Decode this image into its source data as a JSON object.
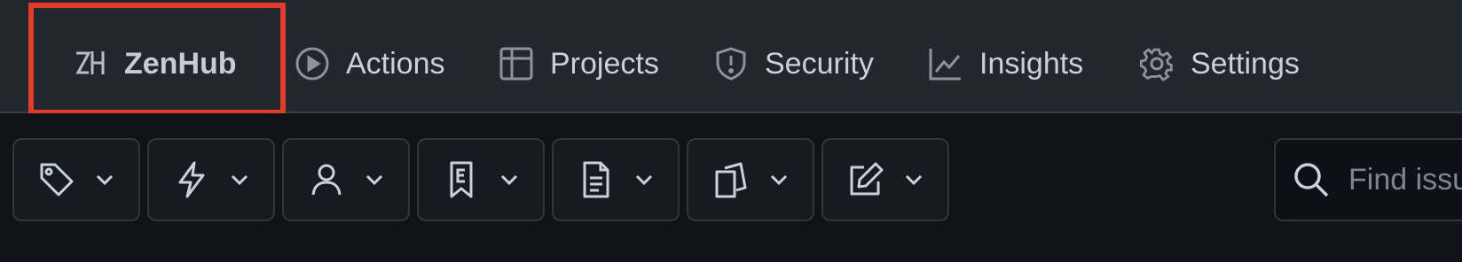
{
  "tabs": [
    {
      "label": "ZenHub",
      "icon": "zenhub-logo-icon"
    },
    {
      "label": "Actions",
      "icon": "play-circle-icon"
    },
    {
      "label": "Projects",
      "icon": "table-icon"
    },
    {
      "label": "Security",
      "icon": "shield-icon"
    },
    {
      "label": "Insights",
      "icon": "graph-icon"
    },
    {
      "label": "Settings",
      "icon": "gear-icon"
    }
  ],
  "highlight_color": "#e23b2a",
  "filters": [
    {
      "icon": "tag-icon"
    },
    {
      "icon": "lightning-icon"
    },
    {
      "icon": "person-icon"
    },
    {
      "icon": "epic-bookmark-icon"
    },
    {
      "icon": "document-icon"
    },
    {
      "icon": "copy-icon"
    },
    {
      "icon": "edit-icon"
    }
  ],
  "search": {
    "placeholder": "Find issues"
  },
  "colors": {
    "tabbar_bg": "#22262d",
    "page_bg": "#0d1117",
    "text": "#c9d1d9"
  }
}
